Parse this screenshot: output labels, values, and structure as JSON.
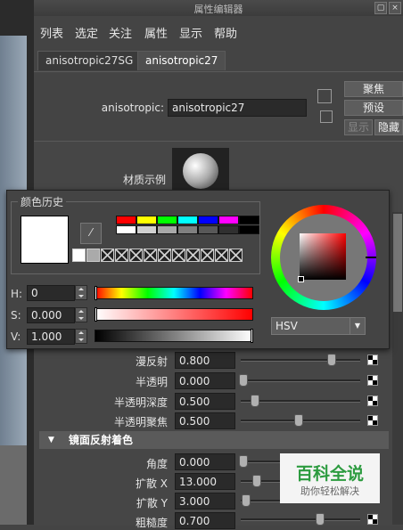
{
  "window": {
    "title": "属性编辑器"
  },
  "menu": [
    "列表",
    "选定",
    "关注",
    "属性",
    "显示",
    "帮助"
  ],
  "tabs": [
    "anisotropic27SG",
    "anisotropic27"
  ],
  "node": {
    "label": "anisotropic:",
    "value": "anisotropic27"
  },
  "side_buttons": {
    "focus": "聚焦",
    "presets": "预设",
    "show": "显示",
    "hide": "隐藏"
  },
  "material_sample_label": "材质示例",
  "color_history": {
    "title": "颜色历史",
    "palette_row1": [
      "#ff0000",
      "#ffff00",
      "#00ff00",
      "#00ffff",
      "#0000ff",
      "#ff00ff",
      "#000000"
    ],
    "palette_row2": [
      "#ffffff",
      "#d0d0d0",
      "#a8a8a8",
      "#808080",
      "#585858",
      "#303030",
      "#000000"
    ]
  },
  "hsv": {
    "h": {
      "label": "H:",
      "value": "0"
    },
    "s": {
      "label": "S:",
      "value": "0.000"
    },
    "v": {
      "label": "V:",
      "value": "1.000"
    },
    "mode": "HSV"
  },
  "attributes": [
    {
      "label": "漫反射",
      "value": "0.800",
      "level": 0.8
    },
    {
      "label": "半透明",
      "value": "0.000",
      "level": 0.0
    },
    {
      "label": "半透明深度",
      "value": "0.500",
      "level": 0.1
    },
    {
      "label": "半透明聚焦",
      "value": "0.500",
      "level": 0.5
    }
  ],
  "section_specular": {
    "title": "镜面反射着色"
  },
  "spec_attributes": [
    {
      "label": "角度",
      "value": "0.000",
      "level": 0.0
    },
    {
      "label": "扩散 X",
      "value": "13.000",
      "level": 0.1
    },
    {
      "label": "扩散 Y",
      "value": "3.000",
      "level": 0.03
    },
    {
      "label": "粗糙度",
      "value": "0.700",
      "level": 0.65
    }
  ],
  "watermark": {
    "title": "百科全说",
    "subtitle": "助你轻松解决"
  }
}
